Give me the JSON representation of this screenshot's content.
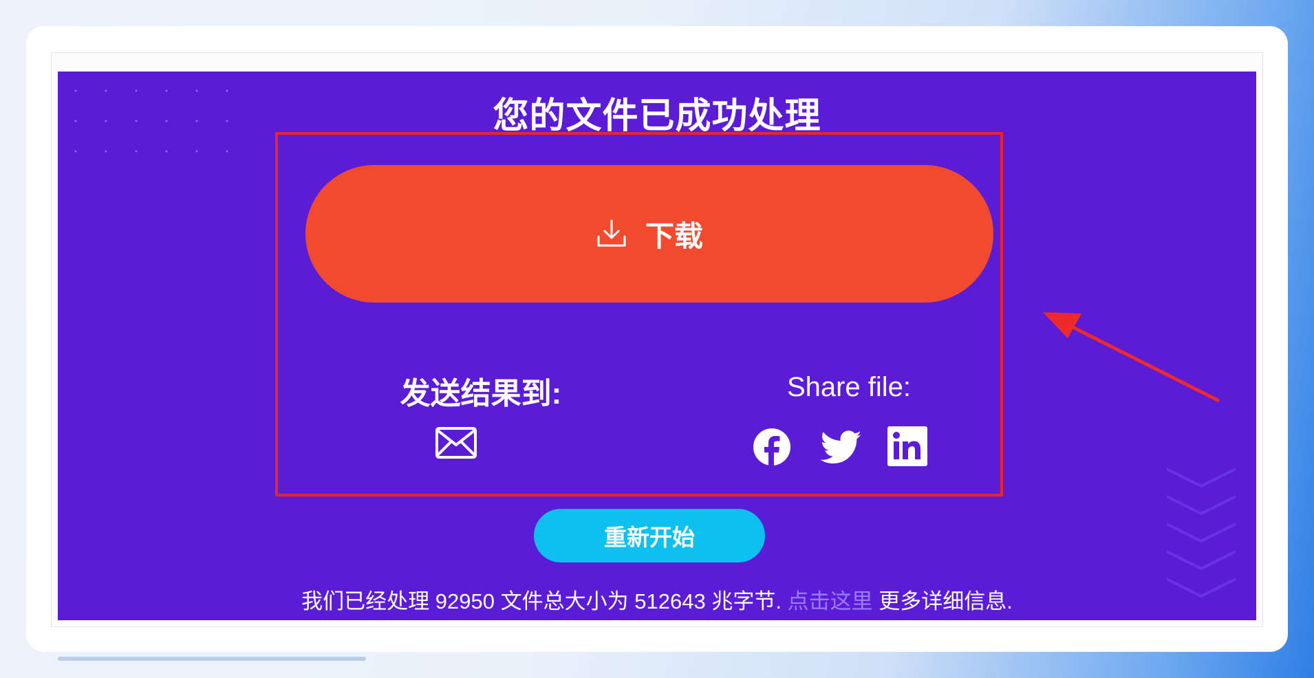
{
  "heading": "您的文件已成功处理",
  "download": {
    "icon": "download-icon",
    "label": "下载"
  },
  "send": {
    "label": "发送结果到:",
    "icon": "mail-icon"
  },
  "share": {
    "label": "Share file:",
    "icons": [
      "facebook-icon",
      "twitter-icon",
      "linkedin-icon"
    ]
  },
  "restart": {
    "label": "重新开始"
  },
  "stats": {
    "prefix": "我们已经处理",
    "file_count": "92950",
    "middle": "文件总大小为",
    "total_size": "512643",
    "unit": "兆字节.",
    "link_text": "点击这里",
    "suffix": "更多详细信息."
  },
  "colors": {
    "panel": "#5b1cd8",
    "download_button": "#f04b2e",
    "restart_button": "#0ec0ef",
    "highlight_box": "#e8252d",
    "annotation_arrow": "#ee2a2a",
    "link": "#9b7cff"
  }
}
